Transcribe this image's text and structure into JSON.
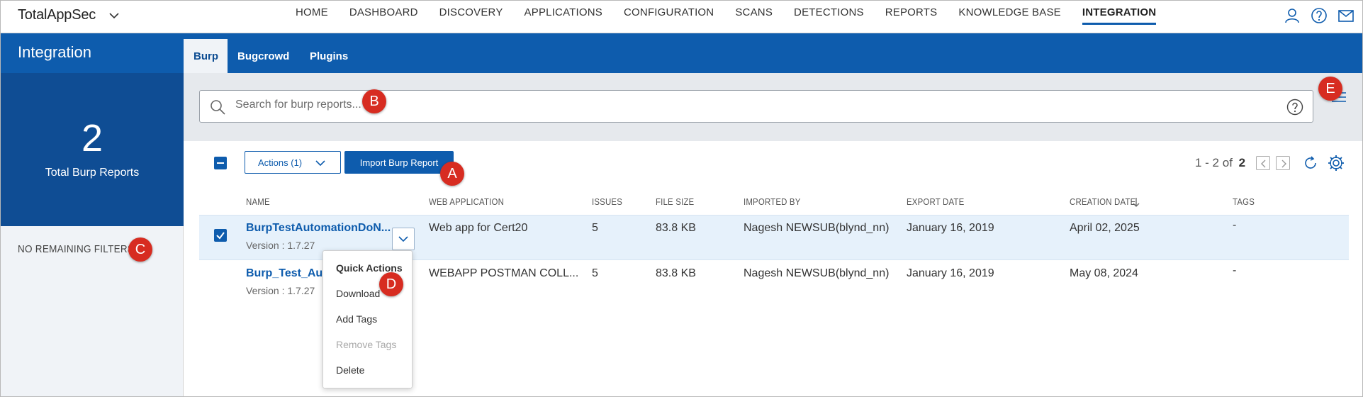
{
  "app": {
    "brand": "TotalAppSec"
  },
  "nav": [
    "HOME",
    "DASHBOARD",
    "DISCOVERY",
    "APPLICATIONS",
    "CONFIGURATION",
    "SCANS",
    "DETECTIONS",
    "REPORTS",
    "KNOWLEDGE BASE",
    "INTEGRATION"
  ],
  "nav_active": "INTEGRATION",
  "sidebar": {
    "title": "Integration",
    "total_count": "2",
    "total_label": "Total Burp Reports",
    "filters": "NO REMAINING FILTERS"
  },
  "tabs": [
    "Burp",
    "Bugcrowd",
    "Plugins"
  ],
  "search": {
    "placeholder": "Search for burp reports..."
  },
  "toolbar": {
    "actions_label": "Actions (1)",
    "import_label": "Import Burp Report",
    "pager_range": "1 - 2 of",
    "pager_total": "2"
  },
  "table": {
    "headers": [
      "NAME",
      "WEB APPLICATION",
      "ISSUES",
      "FILE SIZE",
      "IMPORTED BY",
      "EXPORT DATE",
      "CREATION DATE",
      "TAGS"
    ],
    "rows": [
      {
        "name": "BurpTestAutomationDoN...",
        "version": "Version : 1.7.27",
        "web_app": "Web app for Cert20",
        "issues": "5",
        "file_size": "83.8 KB",
        "imported_by": "Nagesh NEWSUB(blynd_nn)",
        "export_date": "January 16, 2019",
        "creation_date": "April 02, 2025",
        "tags": "-"
      },
      {
        "name": "Burp_Test_Aut",
        "version": "Version : 1.7.27",
        "web_app": "WEBAPP POSTMAN COLL...",
        "issues": "5",
        "file_size": "83.8 KB",
        "imported_by": "Nagesh NEWSUB(blynd_nn)",
        "export_date": "January 16, 2019",
        "creation_date": "May 08, 2024",
        "tags": "-"
      }
    ]
  },
  "quick_actions": {
    "title": "Quick Actions",
    "items": [
      "Download",
      "Add Tags",
      "Remove Tags",
      "Delete"
    ]
  },
  "callouts": [
    "A",
    "B",
    "C",
    "D",
    "E"
  ],
  "colors": {
    "primary": "#0e5cad",
    "sidebar_dark": "#0f4d94",
    "callout": "#d72c21",
    "selected_row": "#e6f1fb"
  }
}
